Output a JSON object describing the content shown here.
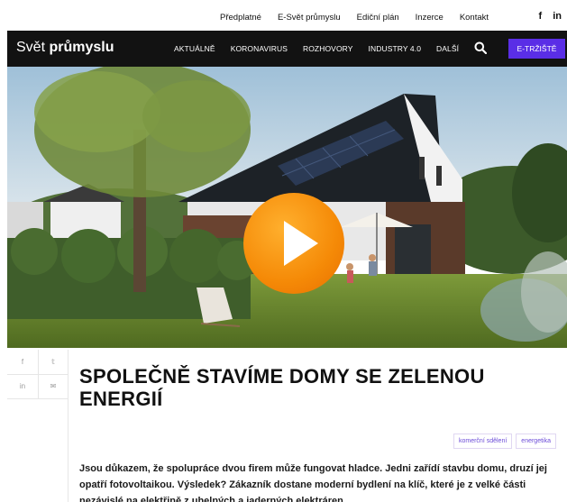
{
  "topbar": {
    "links": [
      "Předplatné",
      "E-Svět průmyslu",
      "Ediční plán",
      "Inzerce",
      "Kontakt"
    ],
    "social": {
      "facebook": "f",
      "linkedin": "in"
    }
  },
  "nav": {
    "logo_light": "Svět ",
    "logo_bold": "průmyslu",
    "items": [
      "AKTUÁLNĚ",
      "KORONAVIRUS",
      "ROZHOVORY",
      "INDUSTRY 4.0",
      "DALŠÍ"
    ],
    "cta": "E-TRŽIŠTĚ"
  },
  "share": {
    "facebook": "f",
    "twitter": "𝕥",
    "linkedin": "in",
    "email": "✉"
  },
  "article": {
    "title": "SPOLEČNĚ STAVÍME DOMY SE ZELENOU ENERGIÍ",
    "tags": [
      "komerční sdělení",
      "energetika"
    ],
    "perex": "Jsou důkazem, že spolupráce dvou firem může fungovat hladce. Jedni zařídí stavbu domu, druzí jej opatří fotovoltaikou. Výsledek? Zákazník dostane moderní bydlení na klíč, které je z velké části nezávislé na elektřině z uhelných a jaderných elektráren."
  },
  "colors": {
    "nav_bg": "#121212",
    "cta": "#5a2ee6",
    "play": "#f58a07",
    "tag_text": "#6b4bd8"
  },
  "icons": [
    "search-icon",
    "play-icon",
    "facebook-icon",
    "linkedin-icon",
    "twitter-icon",
    "email-icon"
  ]
}
